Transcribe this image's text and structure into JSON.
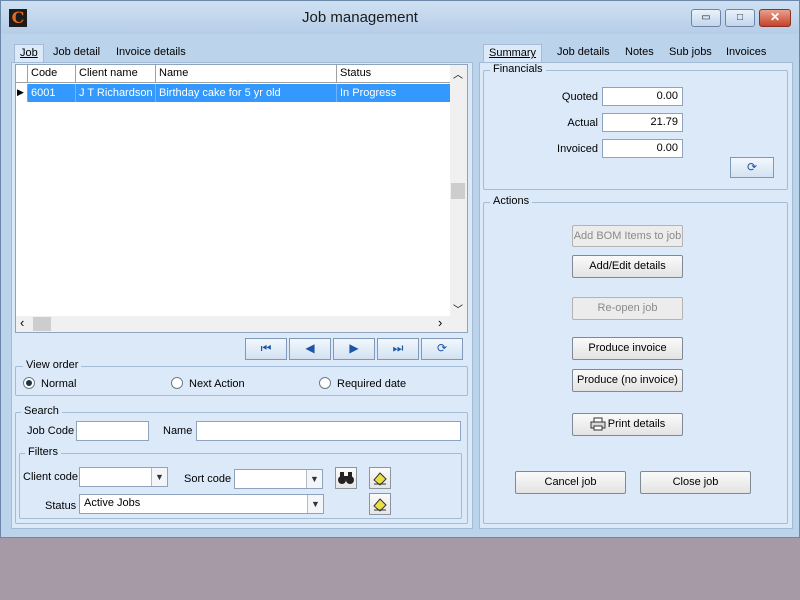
{
  "window": {
    "title": "Job management",
    "app_icon_letter": "C",
    "minimize_glyph": "▭",
    "maximize_glyph": "□",
    "close_glyph": "✕"
  },
  "left_tabs": [
    {
      "label": "Job",
      "active": true
    },
    {
      "label": "Job detail",
      "active": false
    },
    {
      "label": "Invoice details",
      "active": false
    }
  ],
  "grid": {
    "columns": [
      "Code",
      "Client name",
      "Name",
      "Status"
    ],
    "rows": [
      {
        "code": "6001",
        "client": "J T Richardson",
        "name": "Birthday cake for 5 yr old",
        "status": "In Progress",
        "selected": true
      }
    ],
    "row_marker": "▶",
    "scroll_up": "︿",
    "scroll_down": "﹀",
    "scroll_left": "‹",
    "scroll_right": "›"
  },
  "nav": {
    "first": "⏮",
    "prev": "◀",
    "next": "▶",
    "last": "⏭",
    "refresh": "⟳"
  },
  "view_order": {
    "label": "View order",
    "options": [
      "Normal",
      "Next Action",
      "Required date"
    ],
    "selected": "Normal"
  },
  "search": {
    "label": "Search",
    "job_code_label": "Job Code",
    "job_code_value": "",
    "name_label": "Name",
    "name_value": ""
  },
  "filters": {
    "label": "Filters",
    "client_code_label": "Client code",
    "client_code_value": "",
    "sort_code_label": "Sort code",
    "sort_code_value": "",
    "status_label": "Status",
    "status_value": "Active Jobs",
    "find_icon": "binoculars-icon",
    "clear_icon": "eraser-icon"
  },
  "right_tabs": [
    {
      "label": "Summary",
      "active": true
    },
    {
      "label": "Job details",
      "active": false
    },
    {
      "label": "Notes",
      "active": false
    },
    {
      "label": "Sub jobs",
      "active": false
    },
    {
      "label": "Invoices",
      "active": false
    }
  ],
  "financials": {
    "label": "Financials",
    "quoted_label": "Quoted",
    "quoted_value": "0.00",
    "actual_label": "Actual",
    "actual_value": "21.79",
    "invoiced_label": "Invoiced",
    "invoiced_value": "0.00",
    "refresh": "⟳"
  },
  "actions": {
    "label": "Actions",
    "add_bom": "Add BOM Items to job",
    "add_edit": "Add/Edit details",
    "reopen": "Re-open job",
    "produce_invoice": "Produce invoice",
    "produce_no_invoice": "Produce (no invoice)",
    "print_details": "Print details",
    "cancel_job": "Cancel job",
    "close_job": "Close job"
  },
  "colors": {
    "selection": "#3399ff",
    "window_bg": "#bcd3ec",
    "panel_bg": "#dce9f8",
    "desktop": "#a69aa6"
  }
}
